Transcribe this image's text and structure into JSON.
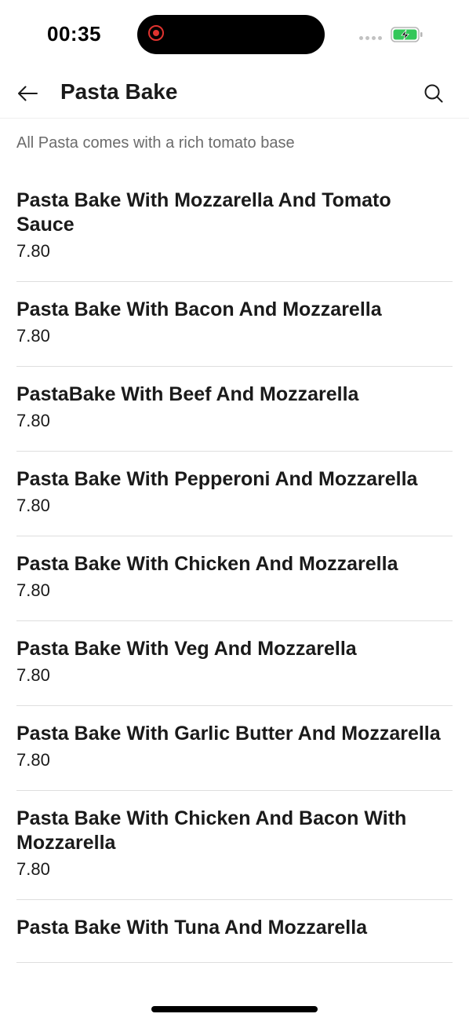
{
  "status_bar": {
    "time": "00:35"
  },
  "header": {
    "title": "Pasta Bake",
    "back_icon": "arrow-left-icon",
    "search_icon": "search-icon"
  },
  "category": {
    "description": "All Pasta comes with a rich tomato base"
  },
  "menu_items": [
    {
      "name": "Pasta Bake With Mozzarella And Tomato Sauce",
      "price": "7.80"
    },
    {
      "name": "Pasta Bake With Bacon And Mozzarella",
      "price": "7.80"
    },
    {
      "name": "PastaBake With Beef And Mozzarella",
      "price": "7.80"
    },
    {
      "name": "Pasta Bake With Pepperoni And Mozzarella",
      "price": "7.80"
    },
    {
      "name": "Pasta Bake With Chicken And Mozzarella",
      "price": "7.80"
    },
    {
      "name": "Pasta Bake With Veg And Mozzarella",
      "price": "7.80"
    },
    {
      "name": "Pasta Bake With Garlic Butter And Mozzarella",
      "price": "7.80"
    },
    {
      "name": "Pasta Bake With Chicken And Bacon With Mozzarella",
      "price": "7.80"
    },
    {
      "name": "Pasta Bake With Tuna And Mozzarella",
      "price": ""
    }
  ],
  "colors": {
    "recording": "#e0332f",
    "battery_charging": "#34c759",
    "divider": "#dedede",
    "description_text": "#6b6b6b"
  }
}
